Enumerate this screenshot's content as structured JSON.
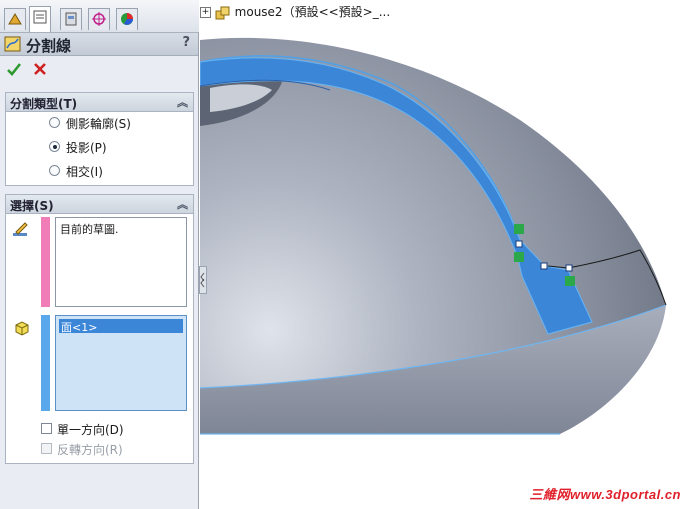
{
  "feature_tree": {
    "plus": "+",
    "label": "mouse2（預設<<預設>_..."
  },
  "property_manager": {
    "title": "分割線",
    "help": "?",
    "tabs": [
      "feature-manager-icon",
      "property-manager-icon",
      "configuration-manager-icon",
      "dimxpert-icon",
      "display-manager-icon"
    ],
    "split_type": {
      "header": "分割類型(T)",
      "options": [
        {
          "label": "側影輪廓(S)",
          "selected": false
        },
        {
          "label": "投影(P)",
          "selected": true
        },
        {
          "label": "相交(I)",
          "selected": false
        }
      ]
    },
    "selections": {
      "header": "選擇(S)",
      "sketch_box_text": "目前的草圖.",
      "faces_box_item": "面<1>",
      "single_direction": "單一方向(D)",
      "reverse_direction": "反轉方向(R)"
    }
  },
  "colors": {
    "accent_blue": "#3c86d8",
    "sketch_pink": "#f07cb8",
    "face_blue": "#5aa8ec",
    "watermark_red": "#e0202a"
  },
  "watermark": "三維网www.3dportal.cn"
}
